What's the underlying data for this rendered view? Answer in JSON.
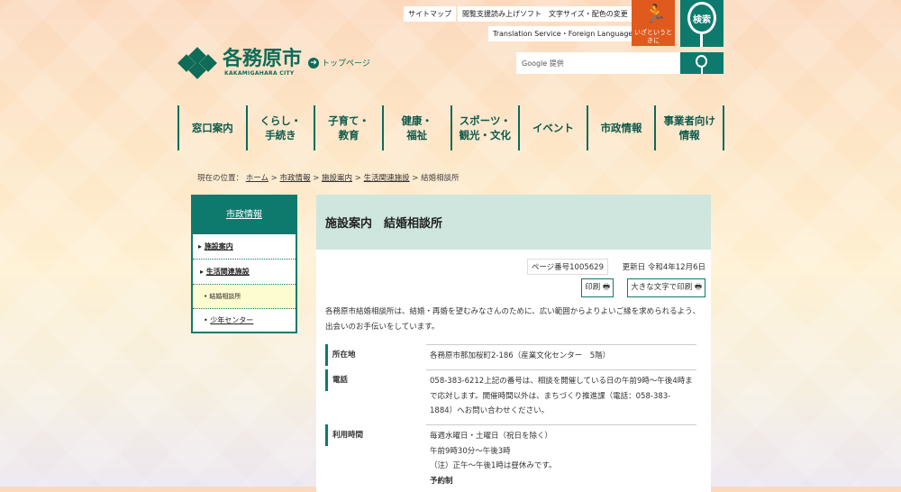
{
  "header": {
    "util_links": [
      "サイトマップ",
      "閲覧支援読み上げソフト",
      "文字サイズ・配色の変更"
    ],
    "translation": "Translation Service・Foreign Language",
    "emergency": "いざというときに",
    "search_label": "検索",
    "logo_name": "各務原市",
    "logo_en": "KAKAMIGAHARA CITY",
    "top_page": "トップページ",
    "google_placeholder": "Google 提供"
  },
  "nav": [
    "窓口案内",
    "くらし・\n手続き",
    "子育て・\n教育",
    "健康・\n福祉",
    "スポーツ・\n観光・文化",
    "イベント",
    "市政情報",
    "事業者向け\n情報"
  ],
  "breadcrumb": {
    "prefix": "現在の位置：",
    "items": [
      "ホーム",
      "市政情報",
      "施設案内",
      "生活関連施設"
    ],
    "current": "結婚相談所"
  },
  "sidebar": {
    "title": "市政情報",
    "items": [
      "施設案内",
      "生活関連施設",
      "結婚相談所",
      "少年センター"
    ]
  },
  "main": {
    "title": "施設案内　結婚相談所",
    "page_number": "ページ番号1005629",
    "updated": "更新日 令和4年12月6日",
    "print": "印刷",
    "print_large": "大きな文字で印刷",
    "lead": "各務原市結婚相談所は、結婚・再婚を望むみなさんのために、広い範囲からよりよいご縁を求められるよう、出会いのお手伝いをしています。",
    "rows": [
      {
        "key": "所在地",
        "value": "各務原市那加桜町2-186（産業文化センター　5階）"
      },
      {
        "key": "電話",
        "value": "058-383-6212上記の番号は、相談を開催している日の午前9時～午後4時まで応対します。開催時間以外は、まちづくり推進課（電話：058-383-1884）へお問い合わせください。"
      },
      {
        "key": "利用時間",
        "lines": [
          "毎週水曜日・土曜日（祝日を除く）",
          "午前9時30分～午後3時",
          "（注）正午～午後1時は昼休みです。",
          "予約制"
        ]
      }
    ]
  }
}
